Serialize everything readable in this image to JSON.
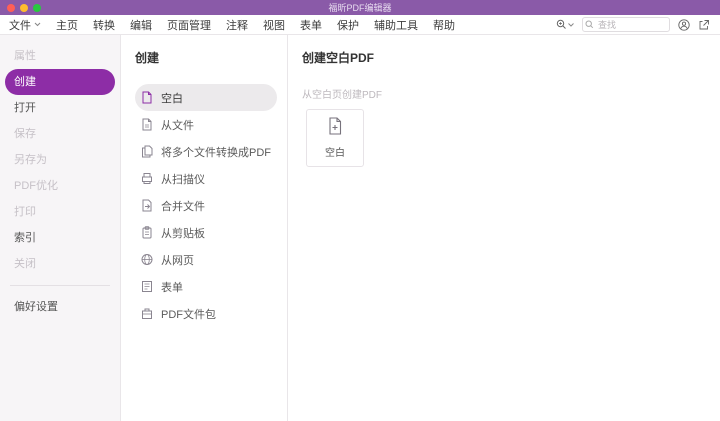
{
  "titlebar": {
    "title": "福昕PDF编辑器"
  },
  "menubar": {
    "items": [
      "文件",
      "主页",
      "转换",
      "编辑",
      "页面管理",
      "注释",
      "视图",
      "表单",
      "保护",
      "辅助工具",
      "帮助"
    ],
    "search_placeholder": "查找"
  },
  "sidebar": {
    "items": [
      {
        "label": "属性",
        "state": "disabled"
      },
      {
        "label": "创建",
        "state": "selected"
      },
      {
        "label": "打开",
        "state": "enabled"
      },
      {
        "label": "保存",
        "state": "disabled"
      },
      {
        "label": "另存为",
        "state": "disabled"
      },
      {
        "label": "PDF优化",
        "state": "disabled"
      },
      {
        "label": "打印",
        "state": "disabled"
      },
      {
        "label": "索引",
        "state": "enabled"
      },
      {
        "label": "关闭",
        "state": "disabled"
      }
    ],
    "preferences": "偏好设置"
  },
  "panel": {
    "title": "创建",
    "items": [
      {
        "label": "空白",
        "icon": "blank-doc-icon",
        "selected": true
      },
      {
        "label": "从文件",
        "icon": "from-file-icon",
        "selected": false
      },
      {
        "label": "将多个文件转换成PDF",
        "icon": "multiple-files-icon",
        "selected": false
      },
      {
        "label": "从扫描仪",
        "icon": "scanner-icon",
        "selected": false
      },
      {
        "label": "合并文件",
        "icon": "combine-files-icon",
        "selected": false
      },
      {
        "label": "从剪贴板",
        "icon": "clipboard-icon",
        "selected": false
      },
      {
        "label": "从网页",
        "icon": "web-page-icon",
        "selected": false
      },
      {
        "label": "表单",
        "icon": "form-icon",
        "selected": false
      },
      {
        "label": "PDF文件包",
        "icon": "pdf-package-icon",
        "selected": false
      }
    ]
  },
  "content": {
    "title": "创建空白PDF",
    "subtitle": "从空白页创建PDF",
    "card_label": "空白"
  },
  "colors": {
    "accent": "#8d2da6",
    "titlebar": "#8a5aa8"
  }
}
